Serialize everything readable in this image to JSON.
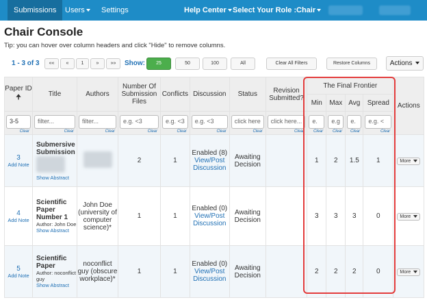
{
  "nav": {
    "submissions": "Submissions",
    "users": "Users",
    "settings": "Settings",
    "help_center": "Help Center",
    "select_role": "Select Your Role :",
    "role": "Chair"
  },
  "page": {
    "title": "Chair Console",
    "tip": "Tip: you can hover over column headers and click \"Hide\" to remove columns."
  },
  "toolbar": {
    "page_count": "1 - 3 of 3",
    "first": "««",
    "prev": "«",
    "page": "1",
    "next": "»",
    "last": "»»",
    "show_label": "Show:",
    "show_options": [
      "25",
      "50",
      "100",
      "All"
    ],
    "clear_filters": "Clear All Filters",
    "restore_columns": "Restore Columns",
    "actions": "Actions"
  },
  "table": {
    "group_header": "The Final Frontier",
    "columns": {
      "paper_id": "Paper ID",
      "title": "Title",
      "authors": "Authors",
      "files": "Number Of Submission Files",
      "conflicts": "Conflicts",
      "discussion": "Discussion",
      "status": "Status",
      "revision": "Revision Submitted?",
      "min": "Min",
      "max": "Max",
      "avg": "Avg",
      "spread": "Spread",
      "actions": "Actions"
    },
    "filters": {
      "paper_id": "3-5",
      "title": "filter...",
      "authors": "filter...",
      "files": "e.g. <3",
      "conflicts": "e.g. <3",
      "discussion": "e.g. <3",
      "status": "click here",
      "revision": "click here...",
      "min": "e.",
      "max": "e.g",
      "avg": "e.",
      "spread": "e.g. <",
      "clear": "Clear"
    },
    "rows": [
      {
        "id": "3",
        "add_note": "Add Note",
        "title": "Submersive Submission",
        "title_author_prefix": "",
        "title_author": "",
        "show_abstract": "Show Abstract",
        "authors": "",
        "files": "2",
        "conflicts": "1",
        "discussion_status": "Enabled (8)",
        "discussion_link": "View/Post Discussion",
        "status": "Awaiting Decision",
        "revision": "",
        "min": "1",
        "max": "2",
        "avg": "1.5",
        "spread": "1",
        "more": "More"
      },
      {
        "id": "4",
        "add_note": "Add Note",
        "title": "Scientific Paper Number 1",
        "title_author_prefix": "Author:",
        "title_author": "John Doe",
        "show_abstract": "Show Abstract",
        "authors": "John Doe (university of computer science)*",
        "files": "1",
        "conflicts": "1",
        "discussion_status": "Enabled (0)",
        "discussion_link": "View/Post Discussion",
        "status": "Awaiting Decision",
        "revision": "",
        "min": "3",
        "max": "3",
        "avg": "3",
        "spread": "0",
        "more": "More"
      },
      {
        "id": "5",
        "add_note": "Add Note",
        "title": "Scientific Paper",
        "title_author_prefix": "Author:",
        "title_author": "noconflict guy",
        "show_abstract": "Show Abstract",
        "authors": "noconflict guy (obscure workplace)*",
        "files": "1",
        "conflicts": "1",
        "discussion_status": "Enabled (0)",
        "discussion_link": "View/Post Discussion",
        "status": "Awaiting Decision",
        "revision": "",
        "min": "2",
        "max": "2",
        "avg": "2",
        "spread": "0",
        "more": "More"
      }
    ]
  },
  "colors": {
    "nav_bg": "#1e8cc7",
    "link": "#1e6fb4",
    "highlight": "#e33b3b",
    "show_active": "#4cae4c"
  }
}
